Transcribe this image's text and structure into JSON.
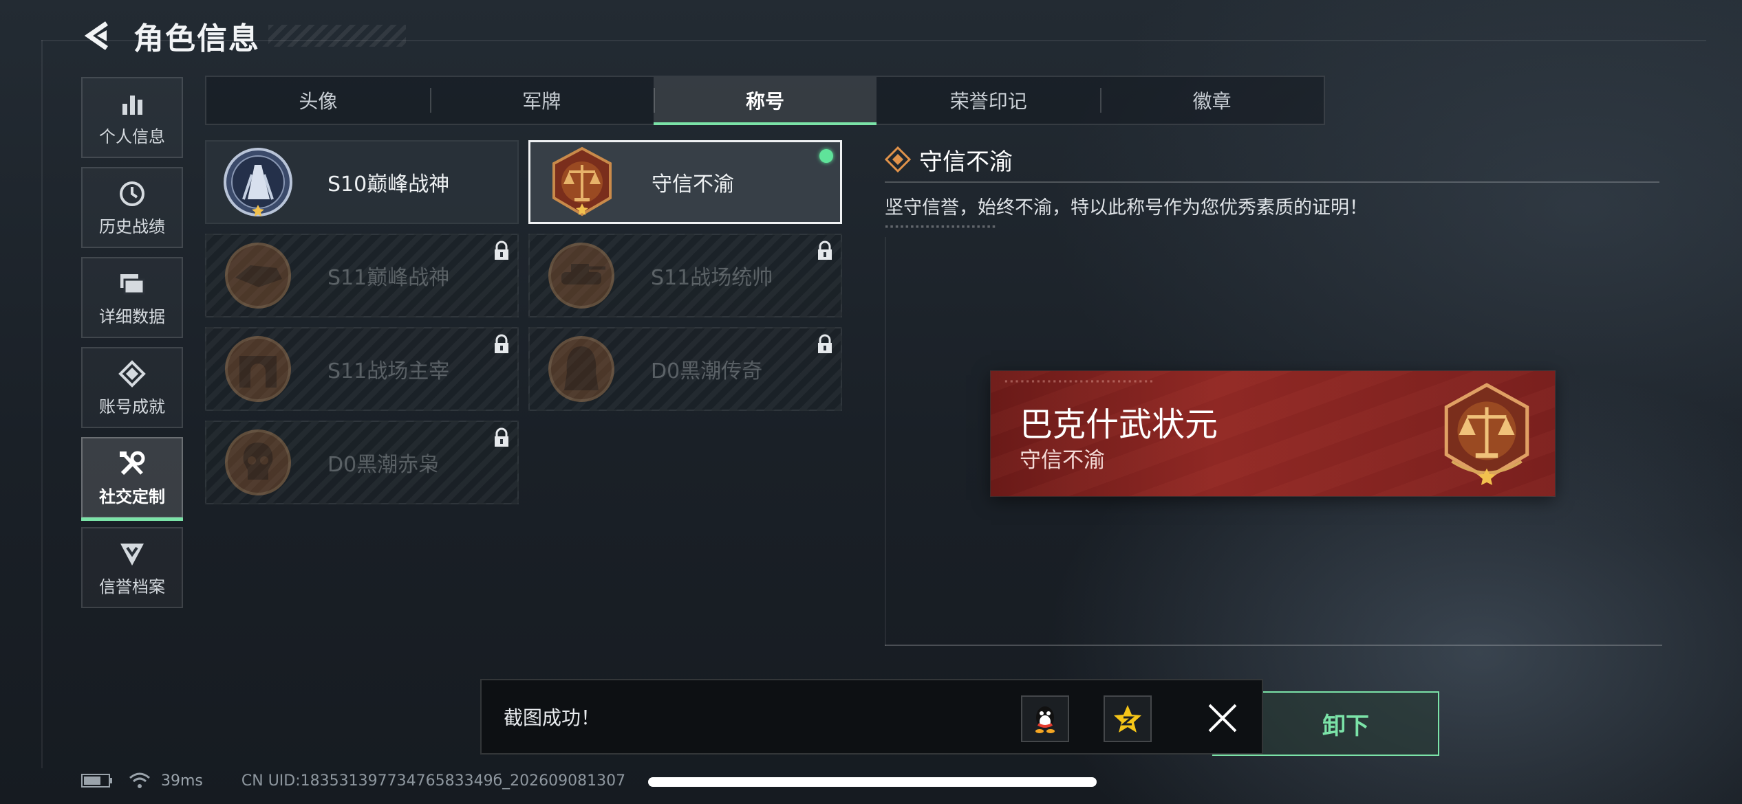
{
  "header": {
    "title": "角色信息"
  },
  "sidebar": {
    "items": [
      {
        "label": "个人信息",
        "icon": "bar-chart-icon",
        "active": false
      },
      {
        "label": "历史战绩",
        "icon": "history-clock-icon",
        "active": false
      },
      {
        "label": "详细数据",
        "icon": "folder-stack-icon",
        "active": false
      },
      {
        "label": "账号成就",
        "icon": "achievement-icon",
        "active": false
      },
      {
        "label": "社交定制",
        "icon": "tools-icon",
        "active": true
      },
      {
        "label": "信誉档案",
        "icon": "shield-chevron-icon",
        "active": false
      }
    ]
  },
  "tabs": [
    {
      "label": "头像",
      "active": false
    },
    {
      "label": "军牌",
      "active": false
    },
    {
      "label": "称号",
      "active": true
    },
    {
      "label": "荣誉印记",
      "active": false
    },
    {
      "label": "徽章",
      "active": false
    }
  ],
  "titles": [
    {
      "label": "S10巅峰战神",
      "locked": false,
      "selected": false
    },
    {
      "label": "守信不渝",
      "locked": false,
      "selected": true,
      "equipped": true
    },
    {
      "label": "S11巅峰战神",
      "locked": true
    },
    {
      "label": "S11战场统帅",
      "locked": true
    },
    {
      "label": "S11战场主宰",
      "locked": true
    },
    {
      "label": "D0黑潮传奇",
      "locked": true
    },
    {
      "label": "D0黑潮赤枭",
      "locked": true
    }
  ],
  "detail": {
    "title": "守信不渝",
    "description": "坚守信誉，始终不渝，特以此称号作为您优秀素质的证明！"
  },
  "nameplate": {
    "player_name": "巴克什武状元",
    "title": "守信不渝"
  },
  "unequip_button": {
    "label": "卸下"
  },
  "toast": {
    "message": "截图成功！"
  },
  "status": {
    "ping": "39ms",
    "uid": "CN UID:18353139773476583349б_202609081307"
  },
  "colors": {
    "accent_green": "#7be3a8",
    "equipped_dot": "#5fe39a",
    "nameplate_red": "#8f2824",
    "emblem_bronze": "#a8612f"
  }
}
